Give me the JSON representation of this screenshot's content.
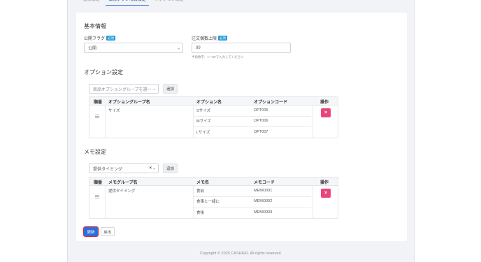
{
  "tabs": [
    {
      "label": "基本設定"
    },
    {
      "label": "価格プラン項目設定"
    },
    {
      "label": "オプション設定"
    }
  ],
  "basic": {
    "heading": "基本情報",
    "publish_label": "公開フラグ",
    "required_badge": "必須",
    "publish_value": "公開",
    "order_limit_label": "注文個数上限",
    "order_limit_value": "99",
    "order_limit_hint": "半角数字、1〜99で入力してください"
  },
  "option": {
    "heading": "オプション設定",
    "group_placeholder": "商品オプショングループを選ー",
    "add_label": "追加",
    "columns": [
      "順番",
      "オプショングループ名",
      "オプション名",
      "オプションコード",
      "操作"
    ],
    "group_name": "サイズ",
    "rows": [
      {
        "name": "Sサイズ",
        "code": "OPT005"
      },
      {
        "name": "Mサイズ",
        "code": "OPT006"
      },
      {
        "name": "Lサイズ",
        "code": "OPT007"
      }
    ],
    "delete_label": "×"
  },
  "memo": {
    "heading": "メモ設定",
    "group_value": "提供タイミング",
    "add_label": "追加",
    "columns": [
      "順番",
      "メモグループ名",
      "メモ名",
      "メモコード",
      "操作"
    ],
    "group_name": "提供タイミング",
    "rows": [
      {
        "name": "食前",
        "code": "MEMO001"
      },
      {
        "name": "食事と一緒に",
        "code": "MEMO002"
      },
      {
        "name": "食後",
        "code": "MEMO003"
      }
    ],
    "delete_label": "×"
  },
  "actions": {
    "update_label": "更新",
    "back_label": "戻る"
  },
  "footer": {
    "copyright": "Copyright © 2025 CASHIER. All rights reserved."
  },
  "colors": {
    "primary": "#2f6ed6",
    "danger": "#e8457a",
    "badge": "#1e9bd7",
    "highlight": "#d9223a"
  }
}
